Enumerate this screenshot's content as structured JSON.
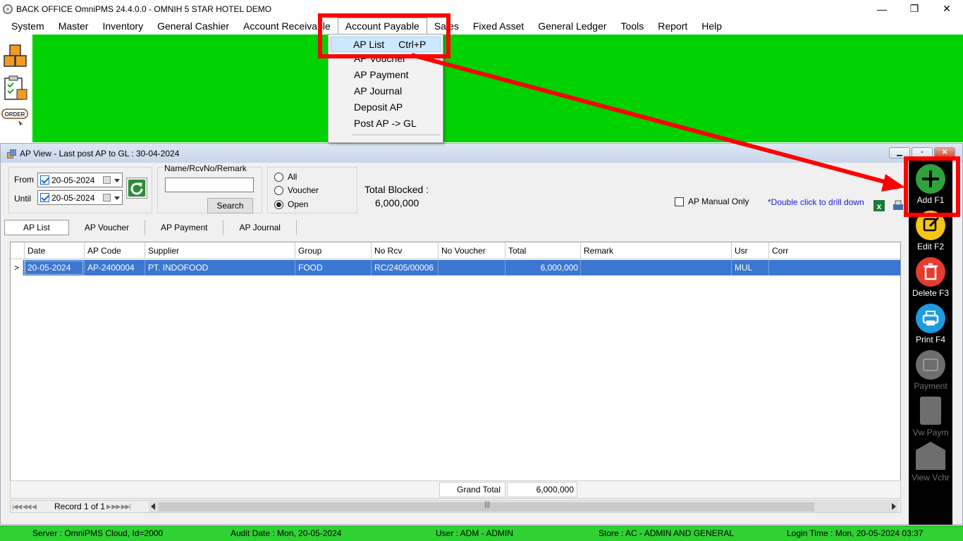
{
  "window": {
    "title": "BACK OFFICE OmniPMS 24.4.0.0 - OMNIH 5 STAR HOTEL DEMO",
    "minimize": "—",
    "maximize": "❐",
    "close": "✕"
  },
  "menubar": [
    {
      "label": "System"
    },
    {
      "label": "Master"
    },
    {
      "label": "Inventory"
    },
    {
      "label": "General Cashier"
    },
    {
      "label": "Account Receivable"
    },
    {
      "label": "Account Payable"
    },
    {
      "label": "Sales"
    },
    {
      "label": "Fixed Asset"
    },
    {
      "label": "General Ledger"
    },
    {
      "label": "Tools"
    },
    {
      "label": "Report"
    },
    {
      "label": "Help"
    }
  ],
  "dropdown": {
    "selected": {
      "label": "AP List",
      "shortcut": "Ctrl+P"
    },
    "items": [
      "AP Voucher",
      "AP Payment",
      "AP Journal",
      "Deposit AP",
      "Post AP -> GL"
    ]
  },
  "left_toolbar": {
    "order_label": "ORDER"
  },
  "child": {
    "title": "AP View - Last post AP to GL : 30-04-2024",
    "from_label": "From",
    "from_date": "20-05-2024",
    "until_label": "Until",
    "until_date": "20-05-2024",
    "search_group_label": "Name/RcvNo/Remark",
    "search_value": "",
    "search_button": "Search",
    "radios": [
      {
        "label": "All",
        "checked": false
      },
      {
        "label": "Voucher",
        "checked": false
      },
      {
        "label": "Open",
        "checked": true
      }
    ],
    "total_blocked_label": "Total Blocked :",
    "total_blocked_value": "6,000,000",
    "manual_only_label": "AP Manual Only",
    "drill_hint": "*Double click to drill down",
    "tabs": [
      {
        "label": "AP List",
        "active": true
      },
      {
        "label": "AP Voucher"
      },
      {
        "label": "AP Payment"
      },
      {
        "label": "AP Journal"
      }
    ],
    "grid": {
      "columns": [
        "Date",
        "AP Code",
        "Supplier",
        "Group",
        "No Rcv",
        "No Voucher",
        "Total",
        "Remark",
        "Usr",
        "Corr"
      ],
      "rows": [
        [
          "20-05-2024",
          "AP-2400004",
          "PT. INDOFOOD",
          "FOOD",
          "RC/2405/00006",
          "",
          "6,000,000",
          "",
          "MUL",
          ""
        ]
      ],
      "row_indicator": ">"
    },
    "grand_total_label": "Grand Total",
    "grand_total_value": "6,000,000",
    "navigator": {
      "record": "Record 1 of 1",
      "scroll_grip": "|||"
    }
  },
  "right_panel": [
    {
      "label": "Add F1",
      "icon": "plus-icon",
      "color": "#2fa33b",
      "enabled": true
    },
    {
      "label": "Edit F2",
      "icon": "edit-icon",
      "color": "#f5c518",
      "enabled": true
    },
    {
      "label": "Delete F3",
      "icon": "trash-icon",
      "color": "#e63c2e",
      "enabled": true
    },
    {
      "label": "Print F4",
      "icon": "printer-icon",
      "color": "#1e9be0",
      "enabled": true
    },
    {
      "label": "Payment",
      "icon": "wallet-icon",
      "color": "#6e6e6e",
      "enabled": false
    },
    {
      "label": "Vw Paym",
      "icon": "list-icon",
      "color": "#6e6e6e",
      "enabled": false
    },
    {
      "label": "View Vchr",
      "icon": "box-icon",
      "color": "#6e6e6e",
      "enabled": false
    }
  ],
  "statusbar": {
    "server": "Server : OmniPMS Cloud, Id=2000",
    "audit": "Audit Date : Mon, 20-05-2024",
    "user": "User : ADM - ADMIN",
    "store": "Store : AC - ADMIN AND GENERAL",
    "login": "Login Time : Mon, 20-05-2024 03:37"
  },
  "colors": {
    "mdi_background": "#00d100",
    "statusbar": "#2fd233",
    "selection": "#3b76d1",
    "highlight": "#ff0000"
  }
}
